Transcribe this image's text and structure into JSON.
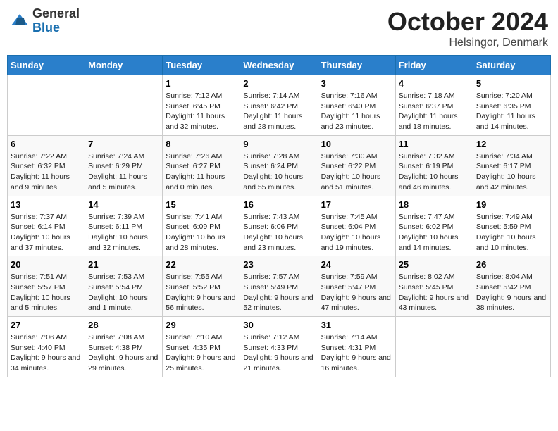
{
  "header": {
    "logo_general": "General",
    "logo_blue": "Blue",
    "month_title": "October 2024",
    "location": "Helsingor, Denmark"
  },
  "days_of_week": [
    "Sunday",
    "Monday",
    "Tuesday",
    "Wednesday",
    "Thursday",
    "Friday",
    "Saturday"
  ],
  "weeks": [
    [
      {
        "day": "",
        "sunrise": "",
        "sunset": "",
        "daylight": ""
      },
      {
        "day": "",
        "sunrise": "",
        "sunset": "",
        "daylight": ""
      },
      {
        "day": "1",
        "sunrise": "Sunrise: 7:12 AM",
        "sunset": "Sunset: 6:45 PM",
        "daylight": "Daylight: 11 hours and 32 minutes."
      },
      {
        "day": "2",
        "sunrise": "Sunrise: 7:14 AM",
        "sunset": "Sunset: 6:42 PM",
        "daylight": "Daylight: 11 hours and 28 minutes."
      },
      {
        "day": "3",
        "sunrise": "Sunrise: 7:16 AM",
        "sunset": "Sunset: 6:40 PM",
        "daylight": "Daylight: 11 hours and 23 minutes."
      },
      {
        "day": "4",
        "sunrise": "Sunrise: 7:18 AM",
        "sunset": "Sunset: 6:37 PM",
        "daylight": "Daylight: 11 hours and 18 minutes."
      },
      {
        "day": "5",
        "sunrise": "Sunrise: 7:20 AM",
        "sunset": "Sunset: 6:35 PM",
        "daylight": "Daylight: 11 hours and 14 minutes."
      }
    ],
    [
      {
        "day": "6",
        "sunrise": "Sunrise: 7:22 AM",
        "sunset": "Sunset: 6:32 PM",
        "daylight": "Daylight: 11 hours and 9 minutes."
      },
      {
        "day": "7",
        "sunrise": "Sunrise: 7:24 AM",
        "sunset": "Sunset: 6:29 PM",
        "daylight": "Daylight: 11 hours and 5 minutes."
      },
      {
        "day": "8",
        "sunrise": "Sunrise: 7:26 AM",
        "sunset": "Sunset: 6:27 PM",
        "daylight": "Daylight: 11 hours and 0 minutes."
      },
      {
        "day": "9",
        "sunrise": "Sunrise: 7:28 AM",
        "sunset": "Sunset: 6:24 PM",
        "daylight": "Daylight: 10 hours and 55 minutes."
      },
      {
        "day": "10",
        "sunrise": "Sunrise: 7:30 AM",
        "sunset": "Sunset: 6:22 PM",
        "daylight": "Daylight: 10 hours and 51 minutes."
      },
      {
        "day": "11",
        "sunrise": "Sunrise: 7:32 AM",
        "sunset": "Sunset: 6:19 PM",
        "daylight": "Daylight: 10 hours and 46 minutes."
      },
      {
        "day": "12",
        "sunrise": "Sunrise: 7:34 AM",
        "sunset": "Sunset: 6:17 PM",
        "daylight": "Daylight: 10 hours and 42 minutes."
      }
    ],
    [
      {
        "day": "13",
        "sunrise": "Sunrise: 7:37 AM",
        "sunset": "Sunset: 6:14 PM",
        "daylight": "Daylight: 10 hours and 37 minutes."
      },
      {
        "day": "14",
        "sunrise": "Sunrise: 7:39 AM",
        "sunset": "Sunset: 6:11 PM",
        "daylight": "Daylight: 10 hours and 32 minutes."
      },
      {
        "day": "15",
        "sunrise": "Sunrise: 7:41 AM",
        "sunset": "Sunset: 6:09 PM",
        "daylight": "Daylight: 10 hours and 28 minutes."
      },
      {
        "day": "16",
        "sunrise": "Sunrise: 7:43 AM",
        "sunset": "Sunset: 6:06 PM",
        "daylight": "Daylight: 10 hours and 23 minutes."
      },
      {
        "day": "17",
        "sunrise": "Sunrise: 7:45 AM",
        "sunset": "Sunset: 6:04 PM",
        "daylight": "Daylight: 10 hours and 19 minutes."
      },
      {
        "day": "18",
        "sunrise": "Sunrise: 7:47 AM",
        "sunset": "Sunset: 6:02 PM",
        "daylight": "Daylight: 10 hours and 14 minutes."
      },
      {
        "day": "19",
        "sunrise": "Sunrise: 7:49 AM",
        "sunset": "Sunset: 5:59 PM",
        "daylight": "Daylight: 10 hours and 10 minutes."
      }
    ],
    [
      {
        "day": "20",
        "sunrise": "Sunrise: 7:51 AM",
        "sunset": "Sunset: 5:57 PM",
        "daylight": "Daylight: 10 hours and 5 minutes."
      },
      {
        "day": "21",
        "sunrise": "Sunrise: 7:53 AM",
        "sunset": "Sunset: 5:54 PM",
        "daylight": "Daylight: 10 hours and 1 minute."
      },
      {
        "day": "22",
        "sunrise": "Sunrise: 7:55 AM",
        "sunset": "Sunset: 5:52 PM",
        "daylight": "Daylight: 9 hours and 56 minutes."
      },
      {
        "day": "23",
        "sunrise": "Sunrise: 7:57 AM",
        "sunset": "Sunset: 5:49 PM",
        "daylight": "Daylight: 9 hours and 52 minutes."
      },
      {
        "day": "24",
        "sunrise": "Sunrise: 7:59 AM",
        "sunset": "Sunset: 5:47 PM",
        "daylight": "Daylight: 9 hours and 47 minutes."
      },
      {
        "day": "25",
        "sunrise": "Sunrise: 8:02 AM",
        "sunset": "Sunset: 5:45 PM",
        "daylight": "Daylight: 9 hours and 43 minutes."
      },
      {
        "day": "26",
        "sunrise": "Sunrise: 8:04 AM",
        "sunset": "Sunset: 5:42 PM",
        "daylight": "Daylight: 9 hours and 38 minutes."
      }
    ],
    [
      {
        "day": "27",
        "sunrise": "Sunrise: 7:06 AM",
        "sunset": "Sunset: 4:40 PM",
        "daylight": "Daylight: 9 hours and 34 minutes."
      },
      {
        "day": "28",
        "sunrise": "Sunrise: 7:08 AM",
        "sunset": "Sunset: 4:38 PM",
        "daylight": "Daylight: 9 hours and 29 minutes."
      },
      {
        "day": "29",
        "sunrise": "Sunrise: 7:10 AM",
        "sunset": "Sunset: 4:35 PM",
        "daylight": "Daylight: 9 hours and 25 minutes."
      },
      {
        "day": "30",
        "sunrise": "Sunrise: 7:12 AM",
        "sunset": "Sunset: 4:33 PM",
        "daylight": "Daylight: 9 hours and 21 minutes."
      },
      {
        "day": "31",
        "sunrise": "Sunrise: 7:14 AM",
        "sunset": "Sunset: 4:31 PM",
        "daylight": "Daylight: 9 hours and 16 minutes."
      },
      {
        "day": "",
        "sunrise": "",
        "sunset": "",
        "daylight": ""
      },
      {
        "day": "",
        "sunrise": "",
        "sunset": "",
        "daylight": ""
      }
    ]
  ]
}
